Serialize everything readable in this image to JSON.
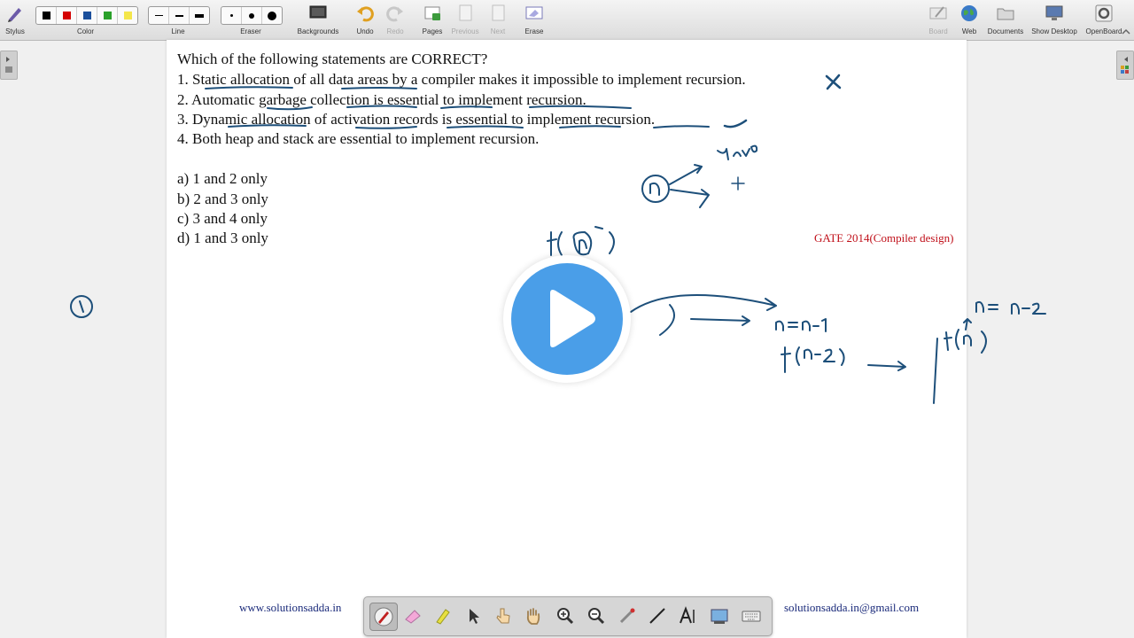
{
  "toolbar": {
    "stylus": "Stylus",
    "color": "Color",
    "line": "Line",
    "eraser": "Eraser",
    "backgrounds": "Backgrounds",
    "undo": "Undo",
    "redo": "Redo",
    "pages": "Pages",
    "previous": "Previous",
    "next": "Next",
    "erase": "Erase",
    "board": "Board",
    "web": "Web",
    "documents": "Documents",
    "show_desktop": "Show Desktop",
    "openboard": "OpenBoard",
    "colors": [
      "#000000",
      "#d40000",
      "#1a4f9c",
      "#2aa12a",
      "#f4e64a"
    ]
  },
  "board": {
    "question": "Which of the following statements are CORRECT?",
    "statements": [
      "1. Static allocation of all data areas by a compiler makes it impossible to implement recursion.",
      "2. Automatic garbage collection is essential to implement recursion.",
      "3. Dynamic allocation of activation records is essential to implement recursion.",
      "4. Both heap and stack are essential to implement recursion."
    ],
    "options": [
      "a) 1 and 2 only",
      "b) 2 and 3 only",
      "c) 3 and 4 only",
      "d) 1 and 3 only"
    ],
    "tag": "GATE 2014(Compiler design)",
    "footer_left": "www.solutionsadda.in",
    "footer_right": "solutionsadda.in@gmail.com"
  },
  "palette": {
    "tools": [
      "pen-icon",
      "eraser-icon",
      "highlighter-icon",
      "pointer-icon",
      "hand-pointer-icon",
      "hand-icon",
      "zoom-in-icon",
      "zoom-out-icon",
      "laser-icon",
      "line-icon",
      "text-icon",
      "capture-icon",
      "keyboard-icon"
    ]
  },
  "ink_color": "#1d4f7a"
}
